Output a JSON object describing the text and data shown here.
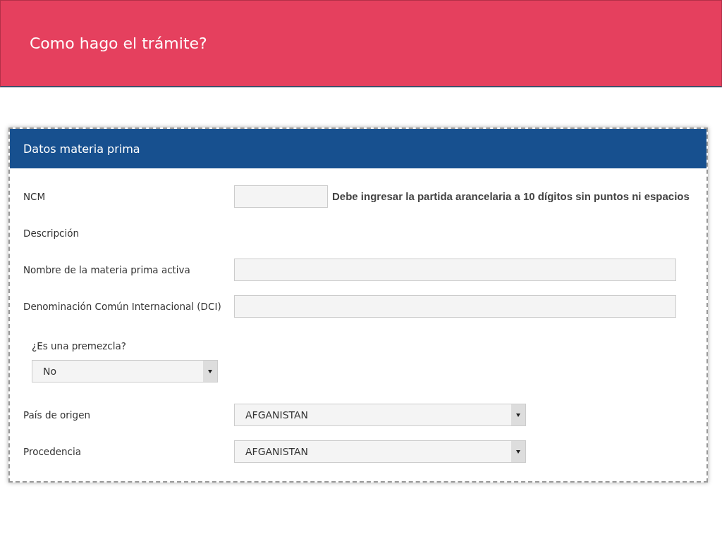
{
  "slide_title": "Como hago el trámite?",
  "panel": {
    "title": "Datos materia prima",
    "fields": [
      {
        "kind": "input",
        "label": "NCM",
        "short": true,
        "hint": "Debe ingresar la partida arancelaria a 10 dígitos sin puntos ni espacios"
      },
      {
        "kind": "heading",
        "label": "Descripción"
      },
      {
        "kind": "input",
        "label": "Nombre de la materia prima activa"
      },
      {
        "kind": "input",
        "label": "Denominación Común Internacional (DCI)"
      },
      {
        "kind": "select",
        "label": "¿Es una premezcla?",
        "value": "No",
        "stacked": true
      },
      {
        "kind": "select",
        "label": "País de origen",
        "value": "AFGANISTAN",
        "stacked": false
      },
      {
        "kind": "select",
        "label": "Procedencia",
        "value": "AFGANISTAN",
        "stacked": false
      }
    ]
  }
}
